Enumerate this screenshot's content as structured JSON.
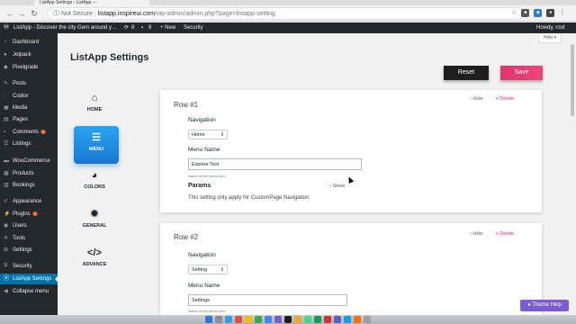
{
  "browser": {
    "tab_title": "ListApp Settings ‹ ListApp —",
    "not_secure": "Not Secure",
    "url_host": "listapp.inspireui.com",
    "url_path": "/wp-admin/admin.php?page=listapp-setting"
  },
  "adminbar": {
    "site": "ListApp - Discover the city Gem around y…",
    "updates": "8",
    "comments": "8",
    "new": "+ New",
    "security": "Security",
    "greeting": "Howdy, root"
  },
  "sidebar": {
    "items": [
      {
        "label": "Dashboard",
        "icon": "dashboard-icon"
      },
      {
        "label": "Jetpack",
        "icon": "jetpack-icon"
      },
      {
        "label": "Pixelgrade",
        "icon": "pixelgrade-icon"
      },
      {
        "label": "Posts",
        "icon": "pin-icon"
      },
      {
        "label": "Codior",
        "icon": "codior-icon"
      },
      {
        "label": "Media",
        "icon": "media-icon"
      },
      {
        "label": "Pages",
        "icon": "page-icon"
      },
      {
        "label": "Comments",
        "icon": "comment-icon",
        "badge": "6"
      },
      {
        "label": "Listings",
        "icon": "listings-icon"
      },
      {
        "label": "WooCommerce",
        "icon": "woocommerce-icon"
      },
      {
        "label": "Products",
        "icon": "products-icon"
      },
      {
        "label": "Bookings",
        "icon": "calendar-icon"
      },
      {
        "label": "Appearance",
        "icon": "brush-icon"
      },
      {
        "label": "Plugins",
        "icon": "plugin-icon",
        "badge": "5"
      },
      {
        "label": "Users",
        "icon": "user-icon"
      },
      {
        "label": "Tools",
        "icon": "wrench-icon"
      },
      {
        "label": "Settings",
        "icon": "settings-icon"
      },
      {
        "label": "Security",
        "icon": "shield-icon"
      },
      {
        "label": "ListApp Settings",
        "icon": "location-icon",
        "active": true
      },
      {
        "label": "Collapse menu",
        "icon": "collapse-icon"
      }
    ]
  },
  "header": {
    "help": "Help",
    "title": "ListApp Settings",
    "reset_label": "Reset",
    "save_label": "Save"
  },
  "nav_panel": [
    {
      "label": "HOME",
      "icon": "home-icon"
    },
    {
      "label": "MENU",
      "icon": "menu-list-icon",
      "active": true
    },
    {
      "label": "COLORS",
      "icon": "palette-icon"
    },
    {
      "label": "GENERAL",
      "icon": "gear-icon"
    },
    {
      "label": "ADVANCE",
      "icon": "code-icon"
    }
  ],
  "rows": [
    {
      "title": "Row #1",
      "hide": "› Hide",
      "delete": "x Delete",
      "navigation_label": "Navigation",
      "navigation_value": "Home",
      "menu_name_label": "Menu Name",
      "menu_name_value": "Explore Test",
      "menu_name_hint": "Name of the menu item",
      "params_label": "Params",
      "show_label": "› Show",
      "note": "This setting only apply for CustomPage Navigation"
    },
    {
      "title": "Row #2",
      "hide": "› Hide",
      "delete": "x Delete",
      "navigation_label": "Navigation",
      "navigation_value": "Setting",
      "menu_name_label": "Menu Name",
      "menu_name_value": "Settings",
      "menu_name_hint": "Name of the menu item"
    }
  ],
  "theme_help": "Theme Help",
  "colors": {
    "admin_dark": "#23282d",
    "active_blue": "#0073aa",
    "save_pink": "#e0336f",
    "menu_gradient": "#1976d2",
    "theme_help": "#7b5cd6"
  }
}
